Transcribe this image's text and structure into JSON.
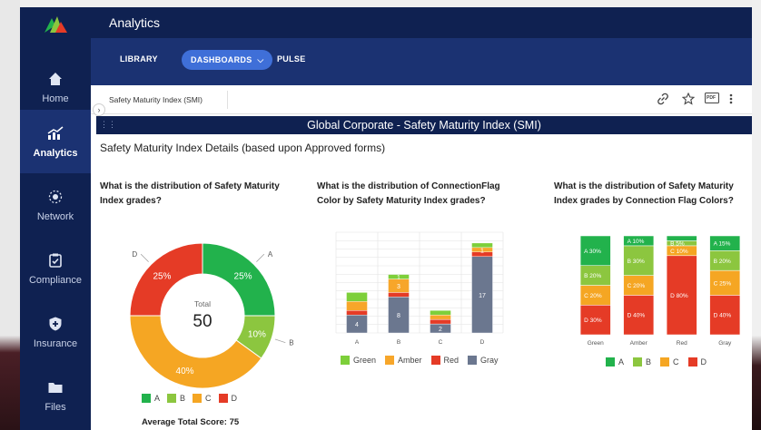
{
  "app": {
    "title": "Analytics"
  },
  "sidebar": {
    "items": [
      {
        "label": "Home",
        "icon": "home-icon"
      },
      {
        "label": "Analytics",
        "icon": "analytics-icon",
        "active": true
      },
      {
        "label": "Network",
        "icon": "network-icon"
      },
      {
        "label": "Compliance",
        "icon": "compliance-icon"
      },
      {
        "label": "Insurance",
        "icon": "insurance-icon"
      },
      {
        "label": "Files",
        "icon": "folder-icon"
      }
    ]
  },
  "tabs": [
    {
      "label": "LIBRARY"
    },
    {
      "label": "DASHBOARDS",
      "active": true
    },
    {
      "label": "PULSE"
    }
  ],
  "breadcrumb": {
    "label": "Safety Maturity Index (SMI)"
  },
  "toolbar": {
    "pdf_label": "PDF"
  },
  "report": {
    "title": "Global Corporate - Safety Maturity Index (SMI)",
    "section_title": "Safety Maturity Index Details (based upon Approved forms)",
    "average_label": "Average Total Score: 75"
  },
  "colors": {
    "A": "#22b24c",
    "B": "#8cc63f",
    "C": "#f5a623",
    "D": "#e53b26",
    "Green": "#7dcf3a",
    "Amber": "#f7a62a",
    "Red": "#e53b26",
    "Gray": "#6b778f",
    "nav_bg": "#0f2151",
    "tab_bg": "#1b3272",
    "accent": "#3f6fd8"
  },
  "chart_data": [
    {
      "type": "pie",
      "question": "What is the distribution of Safety Maturity Index grades?",
      "categories": [
        "A",
        "B",
        "C",
        "D"
      ],
      "values": [
        25,
        10,
        40,
        25
      ],
      "value_labels": [
        "25%",
        "10%",
        "40%",
        "25%"
      ],
      "center_label": "Total",
      "center_value": "50",
      "legend": [
        "A",
        "B",
        "C",
        "D"
      ],
      "legend_placement": "bottom"
    },
    {
      "type": "bar",
      "stacked": true,
      "question": "What is the distribution of ConnectionFlag Color by Safety Maturity Index grades?",
      "categories": [
        "A",
        "B",
        "C",
        "D"
      ],
      "series": [
        {
          "name": "Gray",
          "values": [
            4,
            8,
            2,
            17
          ],
          "labels": [
            "4",
            "8",
            "2",
            "17"
          ]
        },
        {
          "name": "Red",
          "values": [
            1,
            1,
            1,
            1
          ],
          "labels": [
            "",
            "",
            "",
            ""
          ]
        },
        {
          "name": "Amber",
          "values": [
            2,
            3,
            1,
            1
          ],
          "labels": [
            "",
            "3",
            "",
            "1"
          ]
        },
        {
          "name": "Green",
          "values": [
            2,
            1,
            1,
            1
          ],
          "labels": [
            "",
            "1",
            "",
            ""
          ]
        }
      ],
      "legend": [
        "Green",
        "Amber",
        "Red",
        "Gray"
      ],
      "legend_placement": "bottom",
      "grid": true
    },
    {
      "type": "bar",
      "stacked": true,
      "percent": true,
      "question": "What is the distribution of Safety Maturity Index grades by Connection Flag Colors?",
      "categories": [
        "Green",
        "Amber",
        "Red",
        "Gray"
      ],
      "series": [
        {
          "name": "D",
          "values": [
            30,
            40,
            80,
            40
          ],
          "labels": [
            "D 30%",
            "D 40%",
            "D 80%",
            "D 40%"
          ]
        },
        {
          "name": "C",
          "values": [
            20,
            20,
            10,
            25
          ],
          "labels": [
            "C 20%",
            "C 20%",
            "C 10%",
            "C 25%"
          ]
        },
        {
          "name": "B",
          "values": [
            20,
            30,
            5,
            20
          ],
          "labels": [
            "B 20%",
            "B 30%",
            "B 5%",
            "B 20%"
          ]
        },
        {
          "name": "A",
          "values": [
            30,
            10,
            5,
            15
          ],
          "labels": [
            "A 30%",
            "A 10%",
            "",
            "A 15%"
          ]
        }
      ],
      "legend": [
        "A",
        "B",
        "C",
        "D"
      ],
      "legend_placement": "bottom"
    }
  ]
}
